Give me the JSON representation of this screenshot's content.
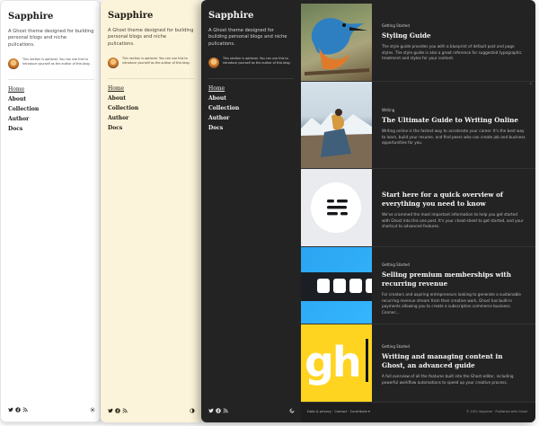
{
  "panels": [
    {
      "theme": "light",
      "site_title": "Sapphire",
      "site_description": "A Ghost theme designed for building personal blogs and niche pulications.",
      "intro_text": "This section is optional. You can use this to introduce yourself as the author of this blog.",
      "nav": [
        "Home",
        "About",
        "Collection",
        "Author",
        "Docs"
      ],
      "mode_icon": "sun-icon"
    },
    {
      "theme": "cream",
      "site_title": "Sapphire",
      "site_description": "A Ghost theme designed for building personal blogs and niche pulications.",
      "intro_text": "This section is optional. You can use this to introduce yourself as the author of this blog.",
      "nav": [
        "Home",
        "About",
        "Collection",
        "Author",
        "Docs"
      ],
      "mode_icon": "contrast-icon"
    },
    {
      "theme": "dark",
      "site_title": "Sapphire",
      "site_description": "A Ghost theme designed for building personal blogs and niche pulications.",
      "intro_text": "This section is optional. You can use this to introduce yourself as the author of this blog.",
      "nav": [
        "Home",
        "About",
        "Collection",
        "Author",
        "Docs"
      ],
      "mode_icon": "moon-icon"
    }
  ],
  "social_icons": [
    "twitter-icon",
    "facebook-icon",
    "rss-icon"
  ],
  "posts": [
    {
      "tag": "Getting Started",
      "title": "Styling Guide",
      "excerpt": "The style guide provides you with a blueprint of default post and page styles. The style guide is also a great reference for suggested typographic treatment and styles for your content.",
      "image": "kingfisher-bird"
    },
    {
      "tag": "Writing",
      "title": "The Ultimate Guide to Writing Online",
      "excerpt": "Writing online is the fastest way to accelerate your career. It's the best way to learn, build your resume, and find peers who can create job and business opportunities for you.",
      "image": "hiker-on-mountain"
    },
    {
      "tag": "Getting Started",
      "title": "Start here for a quick overview of everything you need to know",
      "excerpt": "We've crammed the most important information to help you get started with Ghost into this one post. It's your cheat-sheet to get started, and your shortcut to advanced features.",
      "image": "ghost-logo-circle"
    },
    {
      "tag": "Getting Started",
      "title": "Selling premium memberships with recurring revenue",
      "excerpt": "For creators and aspiring entrepreneurs looking to generate a sustainable recurring revenue stream from their creative work, Ghost has built-in payments allowing you to create a subscription commerce business. Connec...",
      "image": "password-field-graphic"
    },
    {
      "tag": "Getting Started",
      "title": "Writing and managing content in Ghost, an advanced guide",
      "excerpt": "A full overview of all the features built into the Ghost editor, including powerful workflow automations to speed up your creative process.",
      "image": "gh-yellow-graphic",
      "image_text": "gh"
    }
  ],
  "footer": {
    "links": [
      "Data & privacy",
      "Contact",
      "Contribute"
    ],
    "separator": "·",
    "copyright": "© 2021 Sapphire · Published with Ghost"
  },
  "colors": {
    "light_bg": "#ffffff",
    "cream_bg": "#fbf3da",
    "dark_bg": "#232323",
    "ghost_yellow": "#ffd420",
    "membership_blue": "#2ba4f0"
  }
}
